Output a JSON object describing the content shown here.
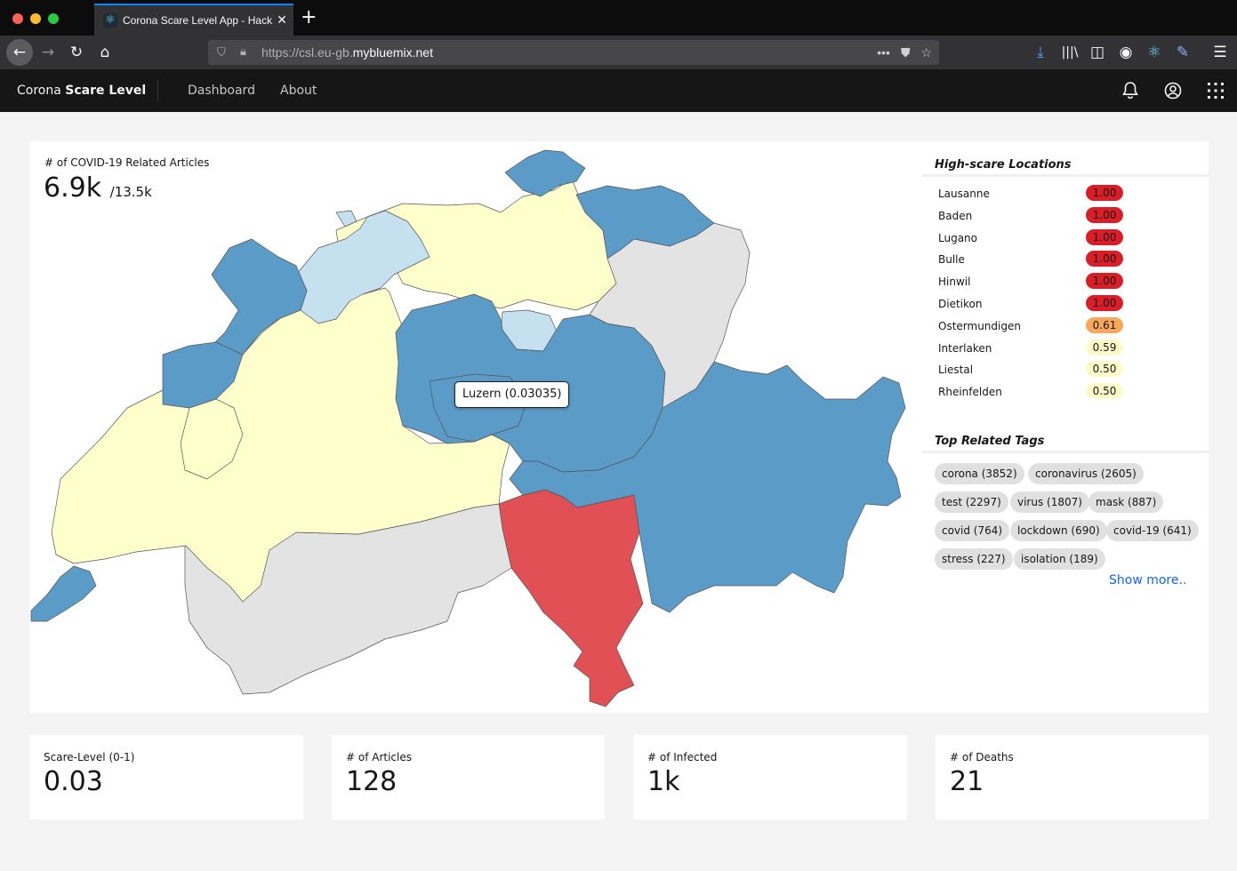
{
  "browser": {
    "tab_title": "Corona Scare Level App - Hack",
    "url_prefix": "https://csl.eu-gb.",
    "url_domain": "mybluemix.net",
    "icons": [
      "back-icon",
      "forward-icon",
      "reload-icon",
      "home-icon",
      "shield-icon",
      "lock-icon",
      "more-icon",
      "pocket-icon",
      "star-icon",
      "download-icon",
      "library-icon",
      "sidebar-icon",
      "account-icon",
      "react-devtools-icon",
      "pen-icon",
      "menu-icon"
    ]
  },
  "header": {
    "brand_plain": "Corona ",
    "brand_bold": "Scare Level",
    "nav": [
      "Dashboard",
      "About"
    ],
    "icons": [
      "bell-icon",
      "user-icon",
      "app-switcher-icon"
    ]
  },
  "main": {
    "kpi_label": "# of COVID-19 Related Articles",
    "kpi_value": "6.9k",
    "kpi_total": "/13.5k",
    "tooltip": "Luzern (0.03035)"
  },
  "colors": {
    "high": "#e05055",
    "medium": "#fdae61",
    "low_yellow": "#ffffcc",
    "light_blue": "#c5e0ee",
    "blue": "#5b9bc8",
    "grey": "#e3e3e3",
    "badge_red": "#da1e28",
    "badge_orange": "#f9a85b",
    "badge_yellow": "#fffbc8",
    "link": "#0f62fe"
  },
  "locations": {
    "title": "High-scare Locations",
    "items": [
      {
        "name": "Lausanne",
        "score": "1.00",
        "level": "red"
      },
      {
        "name": "Baden",
        "score": "1.00",
        "level": "red"
      },
      {
        "name": "Lugano",
        "score": "1.00",
        "level": "red"
      },
      {
        "name": "Bulle",
        "score": "1.00",
        "level": "red"
      },
      {
        "name": "Hinwil",
        "score": "1.00",
        "level": "red"
      },
      {
        "name": "Dietikon",
        "score": "1.00",
        "level": "red"
      },
      {
        "name": "Ostermundigen",
        "score": "0.61",
        "level": "orange"
      },
      {
        "name": "Interlaken",
        "score": "0.59",
        "level": "yellow"
      },
      {
        "name": "Liestal",
        "score": "0.50",
        "level": "yellow"
      },
      {
        "name": "Rheinfelden",
        "score": "0.50",
        "level": "yellow"
      }
    ]
  },
  "tags": {
    "title": "Top Related Tags",
    "items": [
      "corona (3852)",
      "coronavirus (2605)",
      "test (2297)",
      "virus (1807)",
      "mask (887)",
      "covid (764)",
      "lockdown (690)",
      "covid-19 (641)",
      "stress (227)",
      "isolation (189)"
    ],
    "show_more": "Show more.."
  },
  "tiles": [
    {
      "label": "Scare-Level (0-1)",
      "value": "0.03"
    },
    {
      "label": "# of Articles",
      "value": "128"
    },
    {
      "label": "# of Infected",
      "value": "1k"
    },
    {
      "label": "# of Deaths",
      "value": "21"
    }
  ]
}
